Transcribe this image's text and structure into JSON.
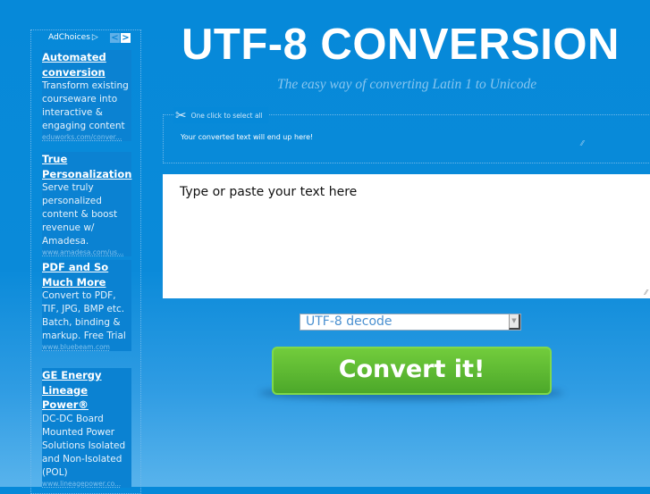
{
  "ads": {
    "adchoices_label": "AdChoices",
    "prev_label": "<",
    "next_label": ">",
    "items": [
      {
        "title": "Automated conversion",
        "body": "Transform existing courseware into interactive & engaging content",
        "url": "eduworks.com/conver..."
      },
      {
        "title": "True Personalization",
        "body": "Serve truly personalized content & boost revenue w/ Amadesa.",
        "url": "www.amadesa.com/us..."
      },
      {
        "title": "PDF and So Much More",
        "body": "Convert to PDF, TIF, JPG, BMP etc. Batch, binding & markup. Free Trial",
        "url": "www.bluebeam.com"
      },
      {
        "title": "GE Energy Lineage Power®",
        "body": "DC-DC Board Mounted Power Solutions Isolated and Non-Isolated (POL)",
        "url": "www.lineagepower.co..."
      }
    ]
  },
  "header": {
    "title": "UTF-8 CONVERSION",
    "subtitle": "The easy way of converting Latin 1 to Unicode"
  },
  "output": {
    "legend": "One click to select all",
    "text": "Your converted text will end up here!"
  },
  "input": {
    "placeholder": "Type or paste your text here"
  },
  "mode_select": {
    "selected": "UTF-8 decode"
  },
  "convert_button": {
    "label": "Convert it!",
    "color": "#5cb832"
  }
}
